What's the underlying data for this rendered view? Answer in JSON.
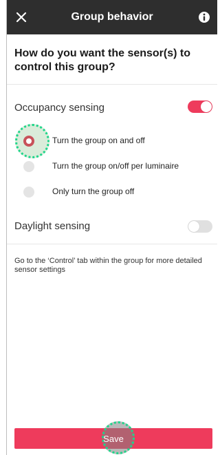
{
  "header": {
    "title": "Group behavior",
    "close_icon": "close-icon",
    "info_icon": "info-icon"
  },
  "question": "How do you want the sensor(s) to control this group?",
  "occupancy": {
    "label": "Occupancy sensing",
    "enabled": true,
    "options": [
      {
        "label": "Turn the group on and off",
        "selected": true
      },
      {
        "label": "Turn the group on/off per luminaire",
        "selected": false
      },
      {
        "label": "Only turn the group off",
        "selected": false
      }
    ]
  },
  "daylight": {
    "label": "Daylight sensing",
    "enabled": false
  },
  "hint": "Go to the ‘Control’ tab within the group for more detailed sensor settings",
  "save_label": "Save",
  "colors": {
    "header_bg": "#2e2e2e",
    "accent": "#ee3b5c",
    "toggle_off": "#e0e0e0",
    "radio_selected": "#c8525a",
    "highlight_ring": "#1fd58a"
  }
}
